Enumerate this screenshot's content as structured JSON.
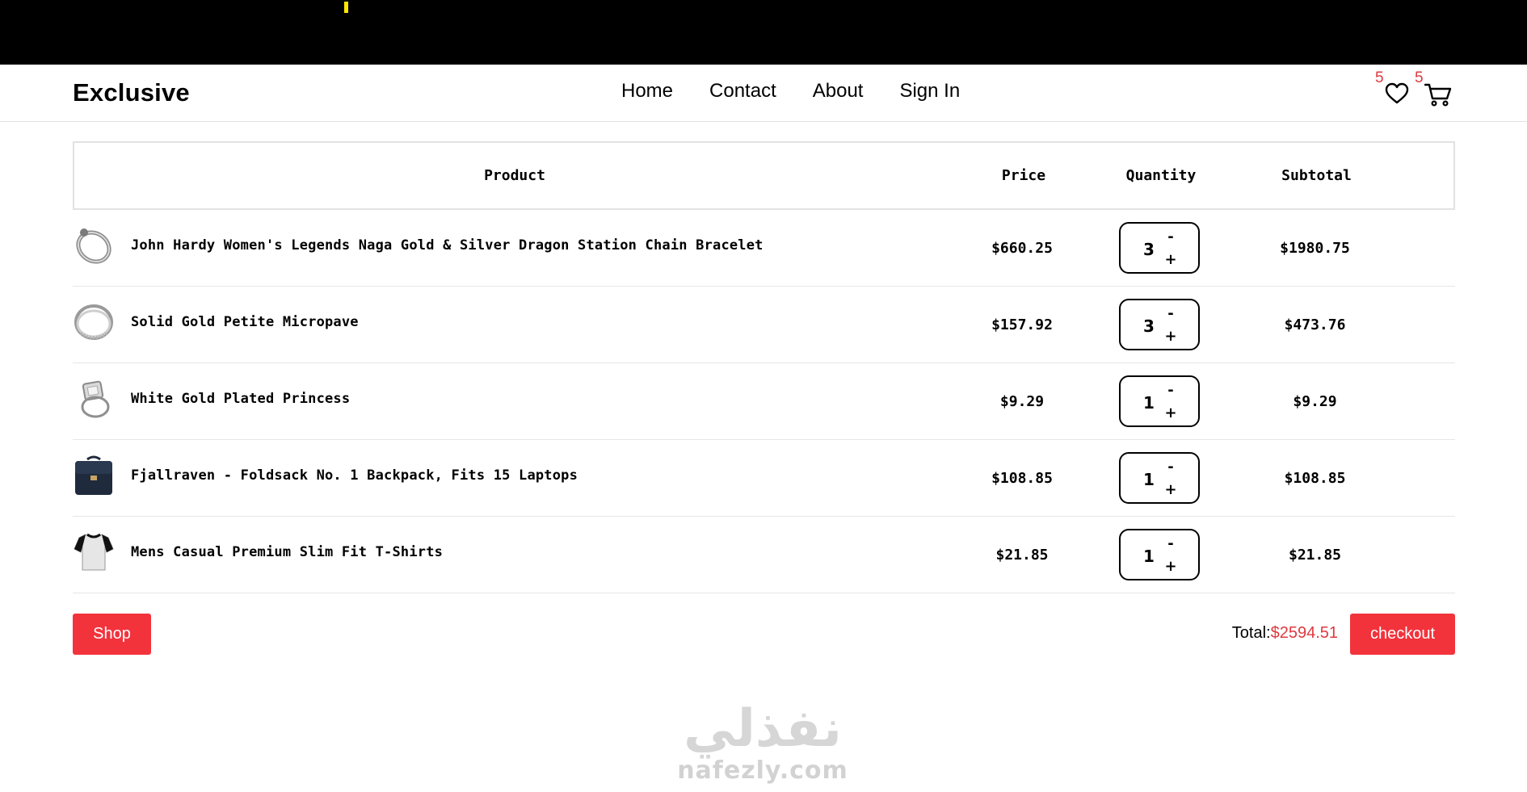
{
  "brand": {
    "name": "Exclusive"
  },
  "nav": {
    "items": [
      {
        "label": "Home"
      },
      {
        "label": "Contact"
      },
      {
        "label": "About"
      },
      {
        "label": "Sign In"
      }
    ]
  },
  "header_icons": {
    "wishlist": {
      "count": "5",
      "icon": "heart-icon"
    },
    "cart": {
      "count": "5",
      "icon": "cart-icon"
    }
  },
  "table": {
    "headers": {
      "product": "Product",
      "price": "Price",
      "quantity": "Quantity",
      "subtotal": "Subtotal"
    },
    "rows": [
      {
        "title": "John Hardy Women's Legends Naga Gold & Silver Dragon Station Chain Bracelet",
        "price": "$660.25",
        "quantity": "3",
        "subtotal": "$1980.75",
        "thumb": "bracelet-image"
      },
      {
        "title": "Solid Gold Petite Micropave",
        "price": "$157.92",
        "quantity": "3",
        "subtotal": "$473.76",
        "thumb": "ring-image"
      },
      {
        "title": "White Gold Plated Princess",
        "price": "$9.29",
        "quantity": "1",
        "subtotal": "$9.29",
        "thumb": "princess-ring-image"
      },
      {
        "title": "Fjallraven - Foldsack No. 1 Backpack, Fits 15 Laptops",
        "price": "$108.85",
        "quantity": "1",
        "subtotal": "$108.85",
        "thumb": "backpack-image"
      },
      {
        "title": "Mens Casual Premium Slim Fit T-Shirts",
        "price": "$21.85",
        "quantity": "1",
        "subtotal": "$21.85",
        "thumb": "tshirt-image"
      }
    ],
    "stepper": {
      "minus": "-",
      "plus": "+"
    }
  },
  "footer": {
    "shop_label": "Shop",
    "total_label": "Total:",
    "total_amount": "$2594.51",
    "checkout_label": "checkout"
  },
  "watermark": {
    "arabic": "نفذلي",
    "latin": "nafezly.com"
  },
  "colors": {
    "accent": "#f2333c",
    "badge": "#e0393e",
    "topbar": "#000000"
  }
}
